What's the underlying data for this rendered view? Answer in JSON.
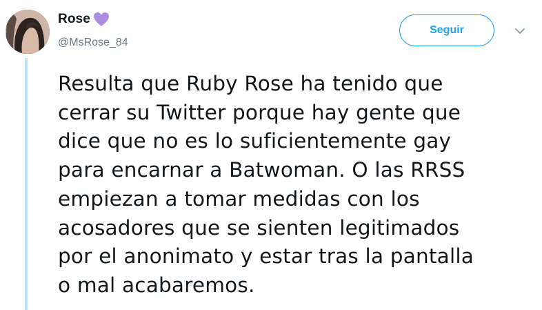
{
  "user": {
    "display_name": "Rose",
    "handle": "@MsRose_84",
    "badge_icon": "purple-heart-icon",
    "avatar_icon": "profile-photo"
  },
  "follow_button": {
    "label": "Seguir"
  },
  "menu": {
    "icon": "chevron-down-icon"
  },
  "tweet": {
    "lines": [
      "Resulta que Ruby Rose ha tenido que",
      "cerrar su Twitter porque hay gente que",
      "dice que no es lo suficientemente gay",
      "para encarnar a Batwoman. O las RRSS",
      "empiezan a tomar medidas con los",
      "acosadores que se sienten legitimados",
      "por el anonimato y estar tras la pantalla",
      "o mal acabaremos."
    ]
  },
  "colors": {
    "accent": "#1da1f2",
    "heart": "#ab8ee0",
    "thread_line": "#c4e2f5",
    "text": "#14171a",
    "secondary_text": "#657786"
  }
}
